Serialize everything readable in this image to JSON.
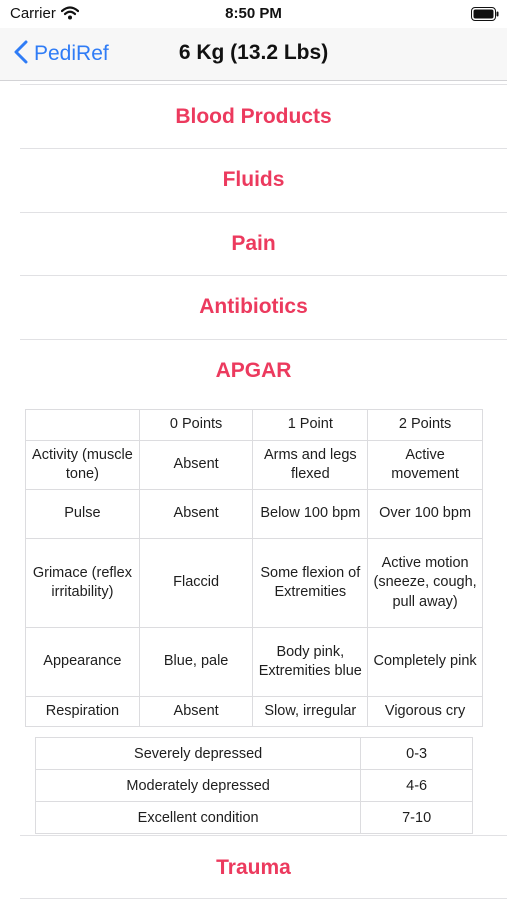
{
  "status_bar": {
    "carrier": "Carrier",
    "time": "8:50 PM"
  },
  "nav": {
    "back_label": "PediRef",
    "title": "6 Kg (13.2 Lbs)"
  },
  "sections": [
    "Blood Products",
    "Fluids",
    "Pain",
    "Antibiotics",
    "APGAR",
    "Trauma"
  ],
  "apgar": {
    "headers": [
      "",
      "0 Points",
      "1 Point",
      "2 Points"
    ],
    "rows": [
      [
        "Activity (muscle tone)",
        "Absent",
        "Arms and legs flexed",
        "Active movement"
      ],
      [
        "Pulse",
        "Absent",
        "Below 100 bpm",
        "Over 100 bpm"
      ],
      [
        "Grimace (reflex irritability)",
        "Flaccid",
        "Some flexion of Extremities",
        "Active motion (sneeze, cough, pull away)"
      ],
      [
        "Appearance",
        "Blue, pale",
        "Body pink, Extremities blue",
        "Completely pink"
      ],
      [
        "Respiration",
        "Absent",
        "Slow, irregular",
        "Vigorous cry"
      ]
    ]
  },
  "score": [
    [
      "Severely depressed",
      "0-3"
    ],
    [
      "Moderately depressed",
      "4-6"
    ],
    [
      "Excellent condition",
      "7-10"
    ]
  ],
  "colors": {
    "accent": "#2f7cf6",
    "section": "#ec3a5e"
  },
  "icons": {
    "wifi": "wifi-icon",
    "battery": "battery-icon",
    "back": "chevron-left-icon"
  }
}
